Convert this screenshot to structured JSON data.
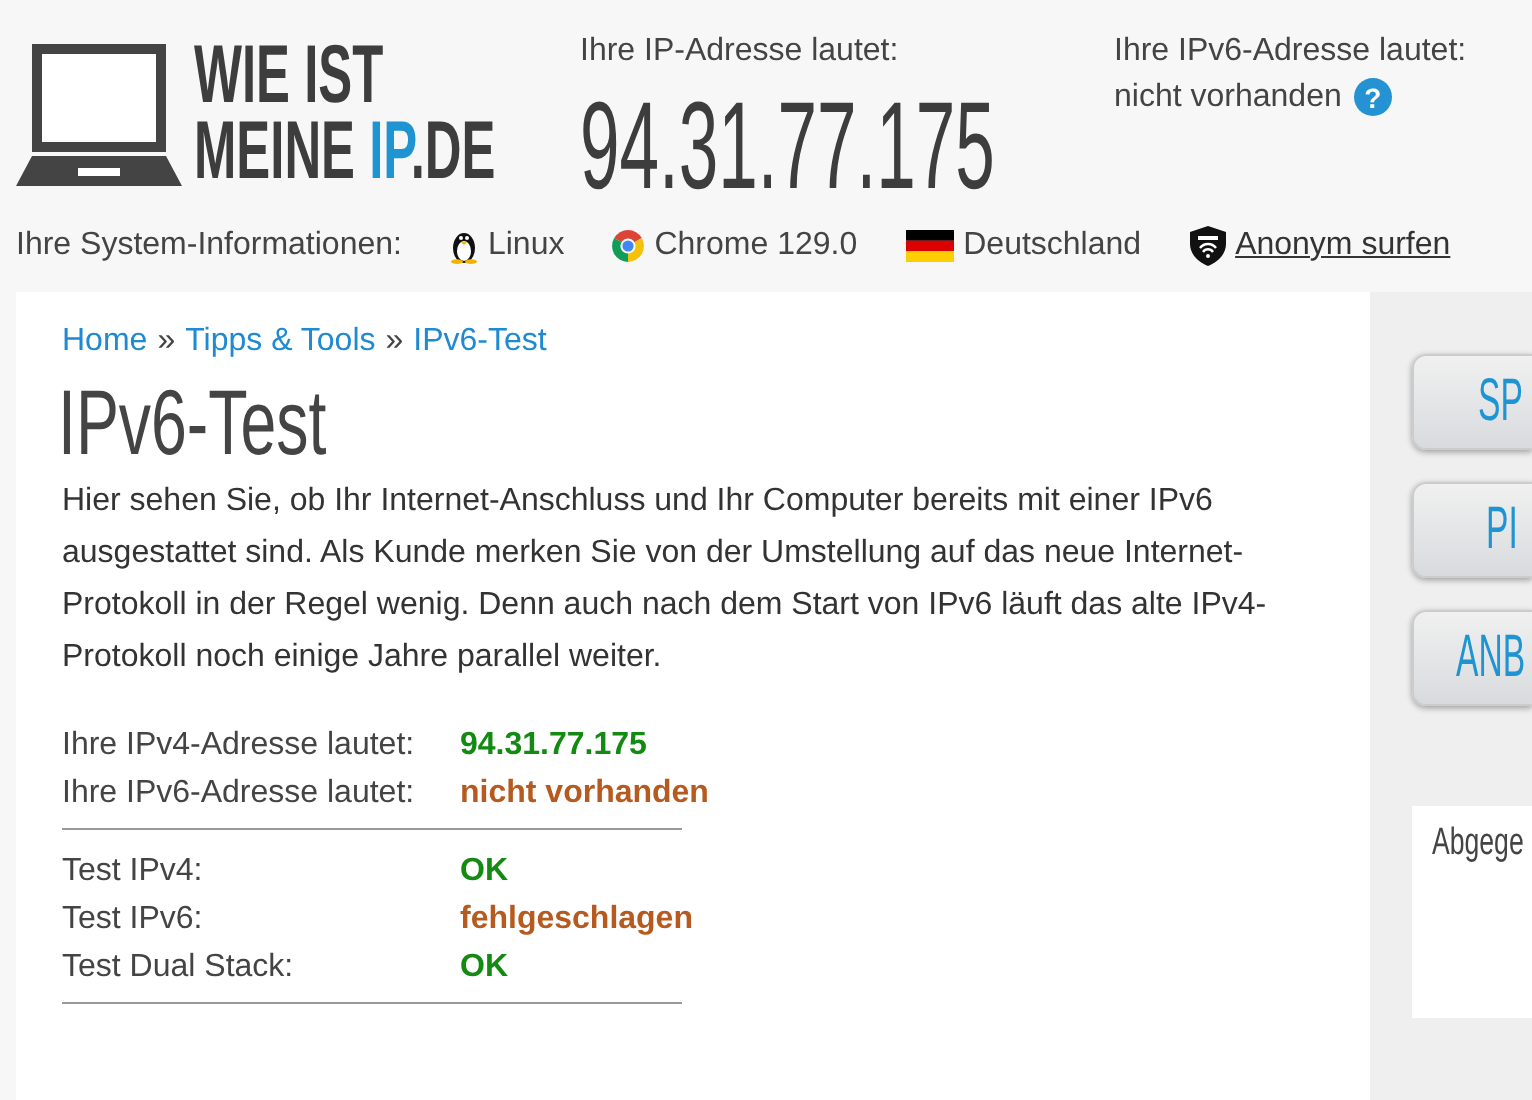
{
  "header": {
    "logo": {
      "line1": "WIE IST",
      "line2_start": "MEINE ",
      "line2_accent": "IP",
      "line2_end": ".DE"
    },
    "ipv4_label": "Ihre IP-Adresse lautet:",
    "ipv4_value": "94.31.77.175",
    "ipv6_label": "Ihre IPv6-Adresse lautet:",
    "ipv6_value": "nicht vorhanden",
    "help_icon": "?"
  },
  "system_info": {
    "label": "Ihre System-Informationen:",
    "items": [
      {
        "kind": "os",
        "text": "Linux"
      },
      {
        "kind": "browser",
        "text": "Chrome 129.0"
      },
      {
        "kind": "country",
        "text": "Deutschland"
      },
      {
        "kind": "link",
        "text": "Anonym surfen"
      }
    ]
  },
  "breadcrumb": {
    "items": [
      {
        "text": "Home"
      },
      {
        "text": "Tipps & Tools"
      },
      {
        "text": "IPv6-Test"
      }
    ],
    "separators": [
      "»",
      "»"
    ]
  },
  "title": "IPv6-Test",
  "intro": "Hier sehen Sie, ob Ihr Internet-Anschluss und Ihr Computer bereits mit einer IPv6 ausgestattet sind. Als Kunde merken Sie von der Umstellung auf das neue Internet-Protokoll in der Regel wenig. Denn auch nach dem Start von IPv6 läuft das alte IPv4-Protokoll noch einige Jahre parallel weiter.",
  "address_rows": [
    {
      "label": "Ihre IPv4-Adresse lautet:",
      "value": "94.31.77.175",
      "color": "#138a12"
    },
    {
      "label": "Ihre IPv6-Adresse lautet:",
      "value": "nicht vorhanden",
      "color": "#b65a1f"
    }
  ],
  "test_rows": [
    {
      "label": "Test IPv4:",
      "value": "OK",
      "color": "#138a12"
    },
    {
      "label": "Test IPv6:",
      "value": "fehlgeschlagen",
      "color": "#b65a1f"
    },
    {
      "label": "Test Dual Stack:",
      "value": "OK",
      "color": "#138a12"
    }
  ],
  "sidebar": {
    "buttons": [
      {
        "text": "SP"
      },
      {
        "text": "PI"
      },
      {
        "text": "ANB"
      }
    ],
    "box_title": "Abgege"
  }
}
